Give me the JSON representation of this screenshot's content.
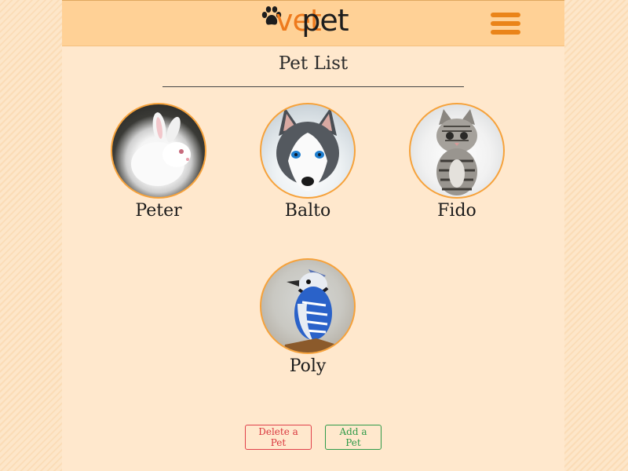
{
  "brand": {
    "pet": "pet",
    "vet": "vet",
    "pet_color": "#1d1d1d",
    "vet_color": "#ee7a1d"
  },
  "header": {
    "menu_icon": "hamburger-menu-icon"
  },
  "main": {
    "title": "Pet List",
    "pets": [
      {
        "name": "Peter",
        "species": "rabbit"
      },
      {
        "name": "Balto",
        "species": "husky puppy"
      },
      {
        "name": "Fido",
        "species": "tabby kitten"
      },
      {
        "name": "Poly",
        "species": "blue jay"
      }
    ]
  },
  "actions": {
    "delete_label": "Delete a Pet",
    "add_label": "Add a Pet",
    "delete_color": "#d9363e",
    "add_color": "#2e9a48"
  }
}
